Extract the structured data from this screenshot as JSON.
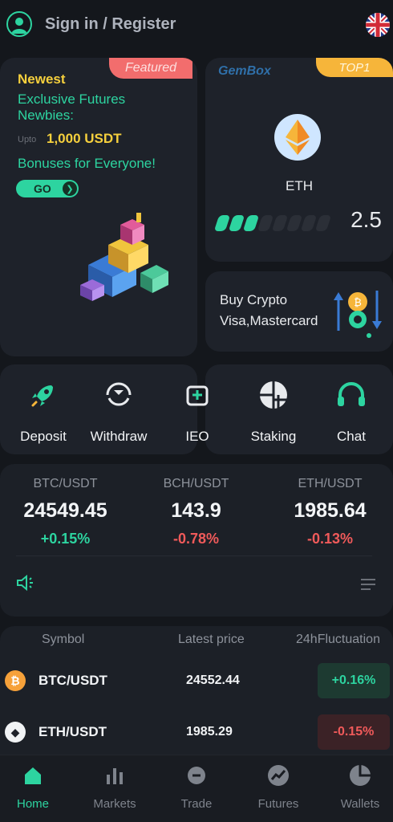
{
  "header": {
    "signin_label": "Sign in / Register",
    "user_icon": "user-avatar-icon",
    "language_icon": "uk-flag-icon"
  },
  "featured": {
    "badge": "Featured",
    "newest": "Newest",
    "line1": "Exclusive Futures",
    "line2": "Newbies:",
    "upto_label": "Upto",
    "upto_amount": "1,000 USDT",
    "bonus": "Bonuses for Everyone!",
    "go_label": "GO"
  },
  "gembox": {
    "label": "GemBox",
    "badge": "TOP1",
    "coin": "ETH",
    "value": "2.5",
    "progress_segments_on": 3,
    "progress_segments_total": 8
  },
  "buy": {
    "line1": "Buy Crypto",
    "line2": "Visa,Mastercard"
  },
  "actions": [
    {
      "label": "Deposit",
      "icon": "rocket-icon"
    },
    {
      "label": "Withdraw",
      "icon": "withdraw-icon"
    },
    {
      "label": "IEO",
      "icon": "ieo-icon"
    },
    {
      "label": "Staking",
      "icon": "staking-icon"
    },
    {
      "label": "Chat",
      "icon": "headset-icon"
    }
  ],
  "tickers": [
    {
      "pair": "BTC/USDT",
      "price": "24549.45",
      "change": "+0.15%"
    },
    {
      "pair": "BCH/USDT",
      "price": "143.9",
      "change": "-0.78%"
    },
    {
      "pair": "ETH/USDT",
      "price": "1985.64",
      "change": "-0.13%"
    }
  ],
  "markets": {
    "headers": {
      "symbol": "Symbol",
      "price": "Latest price",
      "change": "24hFluctuation"
    },
    "rows": [
      {
        "symbol": "BTC/USDT",
        "price": "24552.44",
        "change": "+0.16%",
        "coin_glyph": "₿"
      },
      {
        "symbol": "ETH/USDT",
        "price": "1985.29",
        "change": "-0.15%",
        "coin_glyph": "◆"
      }
    ]
  },
  "nav": [
    {
      "label": "Home",
      "icon": "home-icon"
    },
    {
      "label": "Markets",
      "icon": "bar-chart-icon"
    },
    {
      "label": "Trade",
      "icon": "trade-icon"
    },
    {
      "label": "Futures",
      "icon": "futures-icon"
    },
    {
      "label": "Wallets",
      "icon": "wallet-icon"
    }
  ],
  "colors": {
    "accent": "#2dd4a0",
    "down": "#f05a5a",
    "featured_badge": "#f26d6d",
    "top1_badge": "#f6b53a",
    "highlight": "#f6d03d"
  }
}
